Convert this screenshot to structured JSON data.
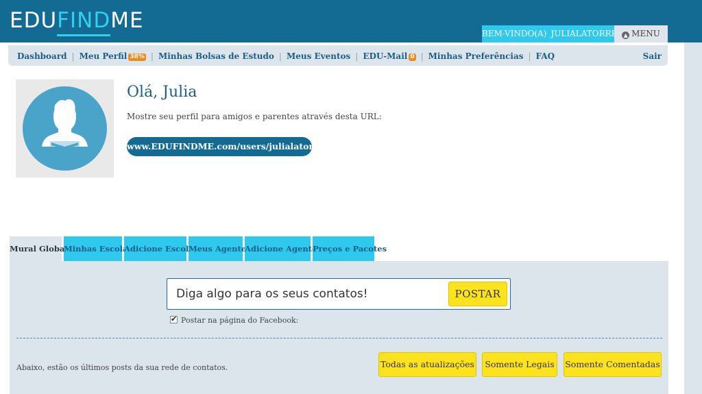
{
  "header": {
    "logo_edu": "EDU",
    "logo_find": "FIND",
    "logo_me": "ME",
    "welcome_label": "BEM-VINDO(A)",
    "username": "JULIALATORRE",
    "menu_label": "MENU",
    "menu_icon": "up-arrow-circle-icon"
  },
  "nav": {
    "items": [
      {
        "label": "Dashboard"
      },
      {
        "label": "Meu Perfil",
        "badge": "38%"
      },
      {
        "label": "Minhas Bolsas de Estudo"
      },
      {
        "label": "Meus Eventos"
      },
      {
        "label": "EDU-Mail",
        "badge": "0"
      },
      {
        "label": "Minhas Preferências"
      },
      {
        "label": "FAQ"
      }
    ],
    "logout": "Sair"
  },
  "profile": {
    "greeting": "Olá, Julia",
    "description": "Mostre seu perfil para amigos e parentes através desta URL:",
    "url": "www.EDUFINDME.com/users/julialatorre",
    "avatar_icon": "user-avatar-icon"
  },
  "tabs": [
    {
      "label": "Mural Global",
      "active": true
    },
    {
      "label": "Minhas Escolas"
    },
    {
      "label": "Adicione Escolas"
    },
    {
      "label": "Meus Agentes"
    },
    {
      "label": "Adicione Agentes"
    },
    {
      "label": "Preços e Pacotes"
    }
  ],
  "wall": {
    "post_placeholder": "Diga algo para os seus contatos!",
    "post_button": "POSTAR",
    "facebook_label": "Postar na página do Facebook:",
    "facebook_checked": true,
    "feed_description": "Abaixo, estão os últimos posts da sua rede de contatos.",
    "filters": [
      "Todas as atualizações",
      "Somente Legais",
      "Somente Comentadas"
    ]
  },
  "colors": {
    "header_bg": "#136a93",
    "accent_cyan": "#2fc8ef",
    "panel_bg": "#dce4ec",
    "button_yellow": "#fde31e",
    "badge_orange": "#f08a1c"
  }
}
